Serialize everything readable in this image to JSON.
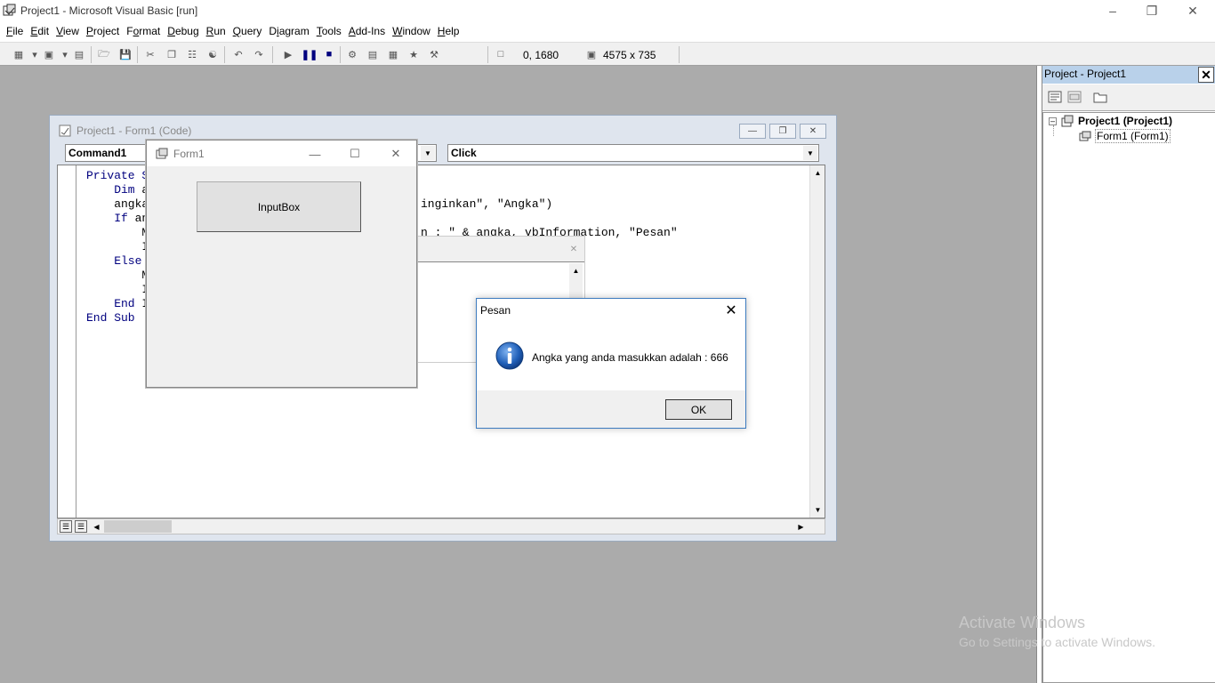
{
  "window": {
    "title": "Project1 - Microsoft Visual Basic [run]"
  },
  "menu": [
    "File",
    "Edit",
    "View",
    "Project",
    "Format",
    "Debug",
    "Run",
    "Query",
    "Diagram",
    "Tools",
    "Add-Ins",
    "Window",
    "Help"
  ],
  "menu_underline": [
    "F",
    "E",
    "V",
    "P",
    "o",
    "D",
    "R",
    "Q",
    "i",
    "T",
    "A",
    "W",
    "H"
  ],
  "toolbar": {
    "position": "0, 1680",
    "size": "4575 x 735"
  },
  "code_window": {
    "title": "Project1 - Form1 (Code)",
    "object_combo": "Command1",
    "procedure_combo": "Click",
    "lines": [
      {
        "kw": "Private S",
        "rest": ""
      },
      {
        "kw": "    Dim",
        "rest": " a"
      },
      {
        "kw": "",
        "rest": "    angka"
      },
      {
        "kw": "    If",
        "rest": " an"
      },
      {
        "kw": "",
        "rest": "        M"
      },
      {
        "kw": "",
        "rest": "        I"
      },
      {
        "kw": "    Else",
        "rest": ""
      },
      {
        "kw": "",
        "rest": "        M"
      },
      {
        "kw": "",
        "rest": "        I"
      },
      {
        "kw": "    End",
        "rest": " I"
      },
      {
        "kw": "End Sub",
        "rest": ""
      }
    ],
    "visible_fragment_1": "inginkan\", \"Angka\")",
    "visible_fragment_2": "n : \" & angka, vbInformation, \"Pesan\""
  },
  "form1": {
    "title": "Form1",
    "button_label": "InputBox"
  },
  "msgbox": {
    "title": "Pesan",
    "message": "Angka yang anda masukkan adalah : 666",
    "ok_label": "OK"
  },
  "project_explorer": {
    "title": "Project - Project1",
    "root": "Project1 (Project1)",
    "child": "Form1 (Form1)"
  },
  "watermark": {
    "line1": "Activate Windows",
    "line2": "Go to Settings to activate Windows."
  }
}
